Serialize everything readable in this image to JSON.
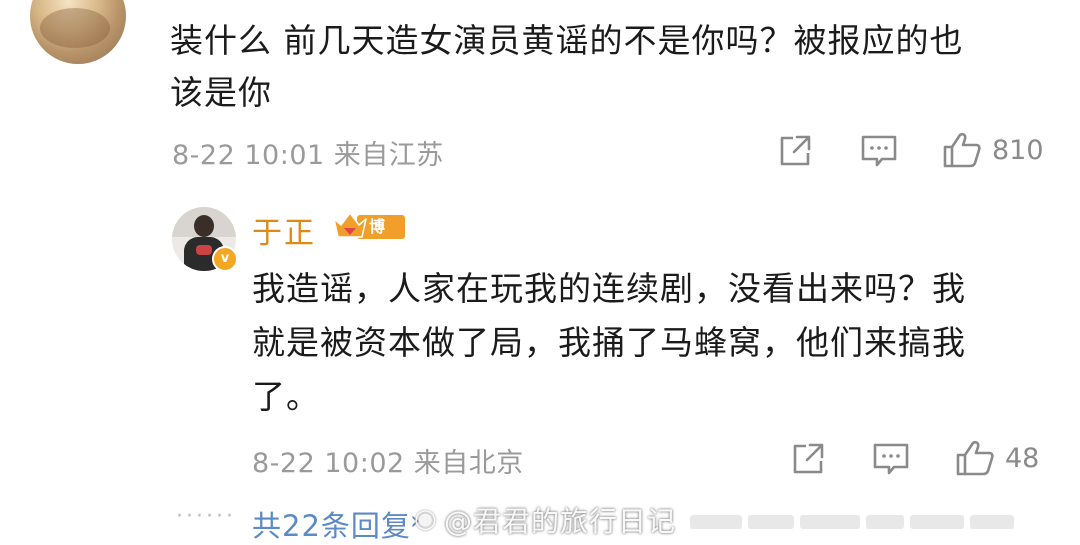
{
  "comment": {
    "text_line1": "装什么 前几天造女演员黄谣的不是你吗？被报应的也",
    "text_line2": "该是你",
    "timestamp": "8-22 10:01",
    "location": "来自江苏",
    "like_count": "810",
    "icons": [
      "share-icon",
      "comment-icon",
      "like-icon"
    ]
  },
  "reply": {
    "username": "于正",
    "badge_label": "博主",
    "verified_mark": "v",
    "text_line1": "我造谣，人家在玩我的连续剧，没看出来吗？我",
    "text_line2": "就是被资本做了局，我捅了马蜂窝，他们来搞我",
    "text_line3": "了。",
    "timestamp": "8-22 10:02",
    "location": "来自北京",
    "like_count": "48",
    "icons": [
      "share-icon",
      "comment-icon",
      "like-icon"
    ]
  },
  "footer": {
    "dots": "······",
    "reply_count_text": "共22条回复",
    "chevron": "›"
  },
  "watermark": {
    "text": "@君君的旅行日记"
  },
  "colors": {
    "username": "#e08a16",
    "link": "#5b8ac7",
    "meta": "#9a9a9a",
    "badge": "#f0a02a"
  }
}
